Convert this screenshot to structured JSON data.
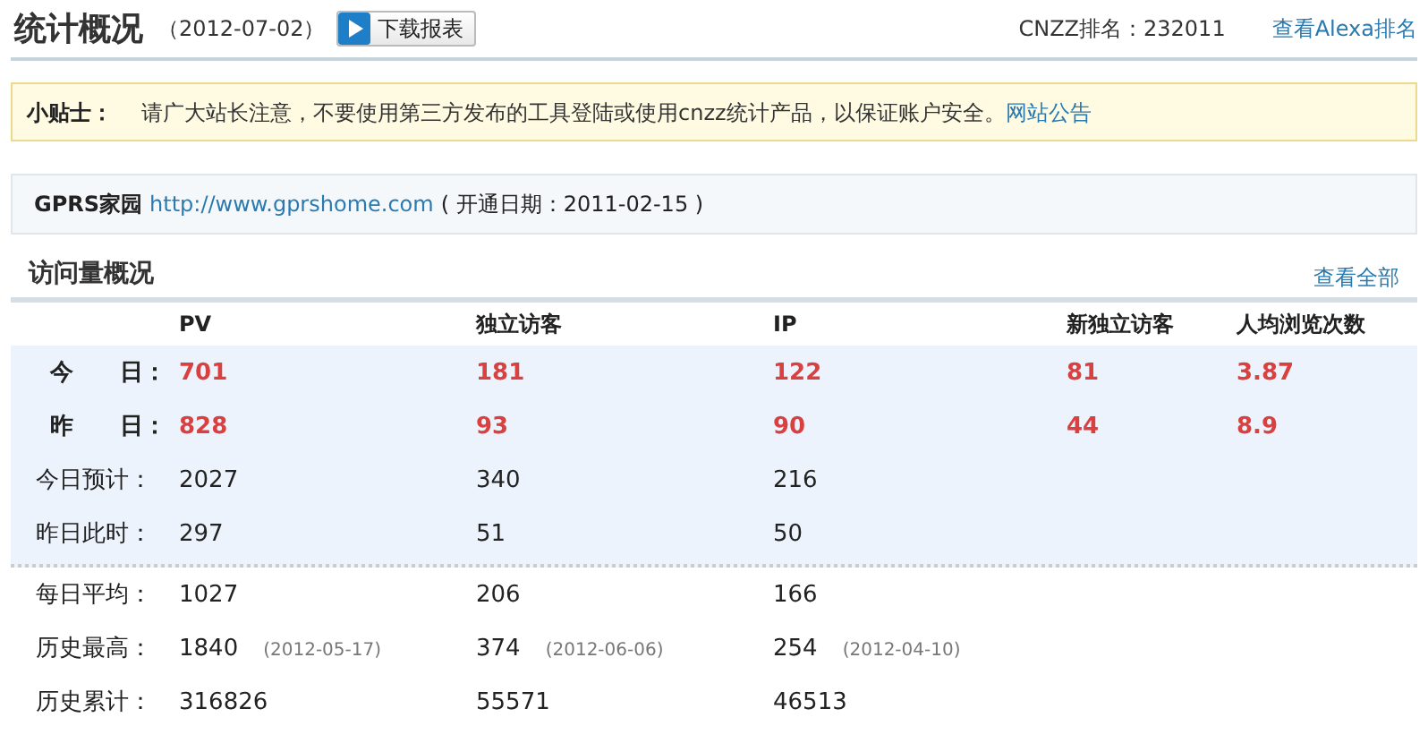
{
  "header": {
    "title": "统计概况",
    "date": "（2012-07-02）",
    "download_button": "下载报表",
    "rank_label": "CNZZ排名：232011",
    "alexa_link": "查看Alexa排名"
  },
  "tip": {
    "label": "小贴士：",
    "text": "请广大站长注意，不要使用第三方发布的工具登陆或使用cnzz统计产品，以保证账户安全。",
    "link": "网站公告"
  },
  "site": {
    "name": "GPRS家园",
    "url": "http://www.gprshome.com",
    "opened": "( 开通日期：2011-02-15 )"
  },
  "overview": {
    "title": "访问量概况",
    "view_all": "查看全部",
    "columns": [
      "PV",
      "独立访客",
      "IP",
      "新独立访客",
      "人均浏览次数"
    ],
    "sections": [
      {
        "shaded": true,
        "rows": [
          {
            "label": "今　　日：",
            "emphasis": true,
            "cells": [
              {
                "value": "701"
              },
              {
                "value": "181"
              },
              {
                "value": "122"
              },
              {
                "value": "81"
              },
              {
                "value": "3.87"
              }
            ]
          },
          {
            "label": "昨　　日：",
            "emphasis": true,
            "cells": [
              {
                "value": "828"
              },
              {
                "value": "93"
              },
              {
                "value": "90"
              },
              {
                "value": "44"
              },
              {
                "value": "8.9"
              }
            ]
          },
          {
            "label": "今日预计：",
            "emphasis": false,
            "cells": [
              {
                "value": "2027"
              },
              {
                "value": "340"
              },
              {
                "value": "216"
              }
            ]
          },
          {
            "label": "昨日此时：",
            "emphasis": false,
            "cells": [
              {
                "value": "297"
              },
              {
                "value": "51"
              },
              {
                "value": "50"
              }
            ]
          }
        ]
      },
      {
        "shaded": false,
        "rows": [
          {
            "label": "每日平均：",
            "emphasis": false,
            "cells": [
              {
                "value": "1027"
              },
              {
                "value": "206"
              },
              {
                "value": "166"
              }
            ]
          },
          {
            "label": "历史最高：",
            "emphasis": false,
            "cells": [
              {
                "value": "1840",
                "date": "(2012-05-17)"
              },
              {
                "value": "374",
                "date": "(2012-06-06)"
              },
              {
                "value": "254",
                "date": "(2012-04-10)"
              }
            ]
          },
          {
            "label": "历史累计：",
            "emphasis": false,
            "cells": [
              {
                "value": "316826"
              },
              {
                "value": "55571"
              },
              {
                "value": "46513"
              }
            ]
          }
        ]
      }
    ]
  }
}
